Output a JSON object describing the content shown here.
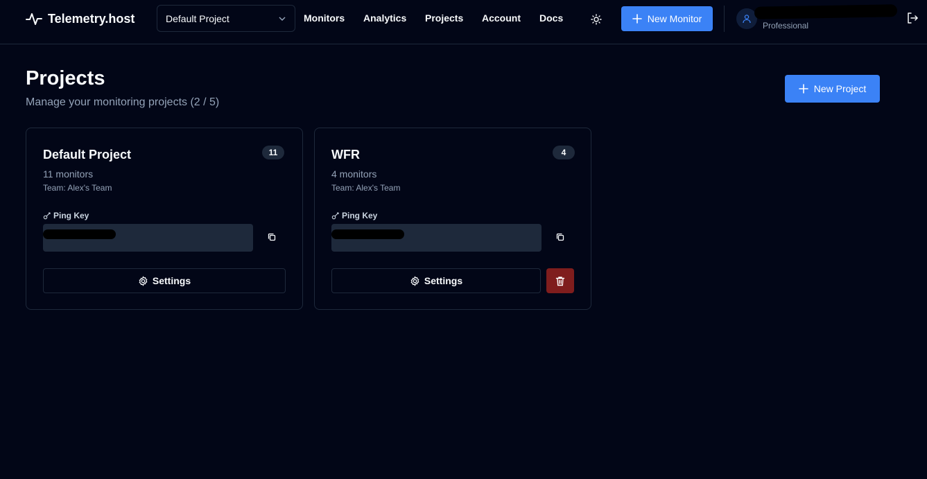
{
  "app": {
    "name": "Telemetry.host",
    "project_selector": "Default Project",
    "nav": [
      "Monitors",
      "Analytics",
      "Projects",
      "Account",
      "Docs"
    ],
    "new_monitor_label": "New Monitor",
    "user_plan": "Professional"
  },
  "page": {
    "title": "Projects",
    "subtitle": "Manage your monitoring projects (2 / 5)",
    "new_project_label": "New Project"
  },
  "projects": [
    {
      "name": "Default Project",
      "count": "11",
      "monitors": "11 monitors",
      "team": "Team: Alex's Team",
      "ping_key_label": "Ping Key",
      "settings_label": "Settings"
    },
    {
      "name": "WFR",
      "count": "4",
      "monitors": "4 monitors",
      "team": "Team: Alex's Team",
      "ping_key_label": "Ping Key",
      "settings_label": "Settings"
    }
  ],
  "colors": {
    "background": "#020617",
    "accent": "#3b82f6",
    "danger": "#7f1d1d",
    "border": "#1e293b",
    "muted_text": "#94a3b8"
  }
}
